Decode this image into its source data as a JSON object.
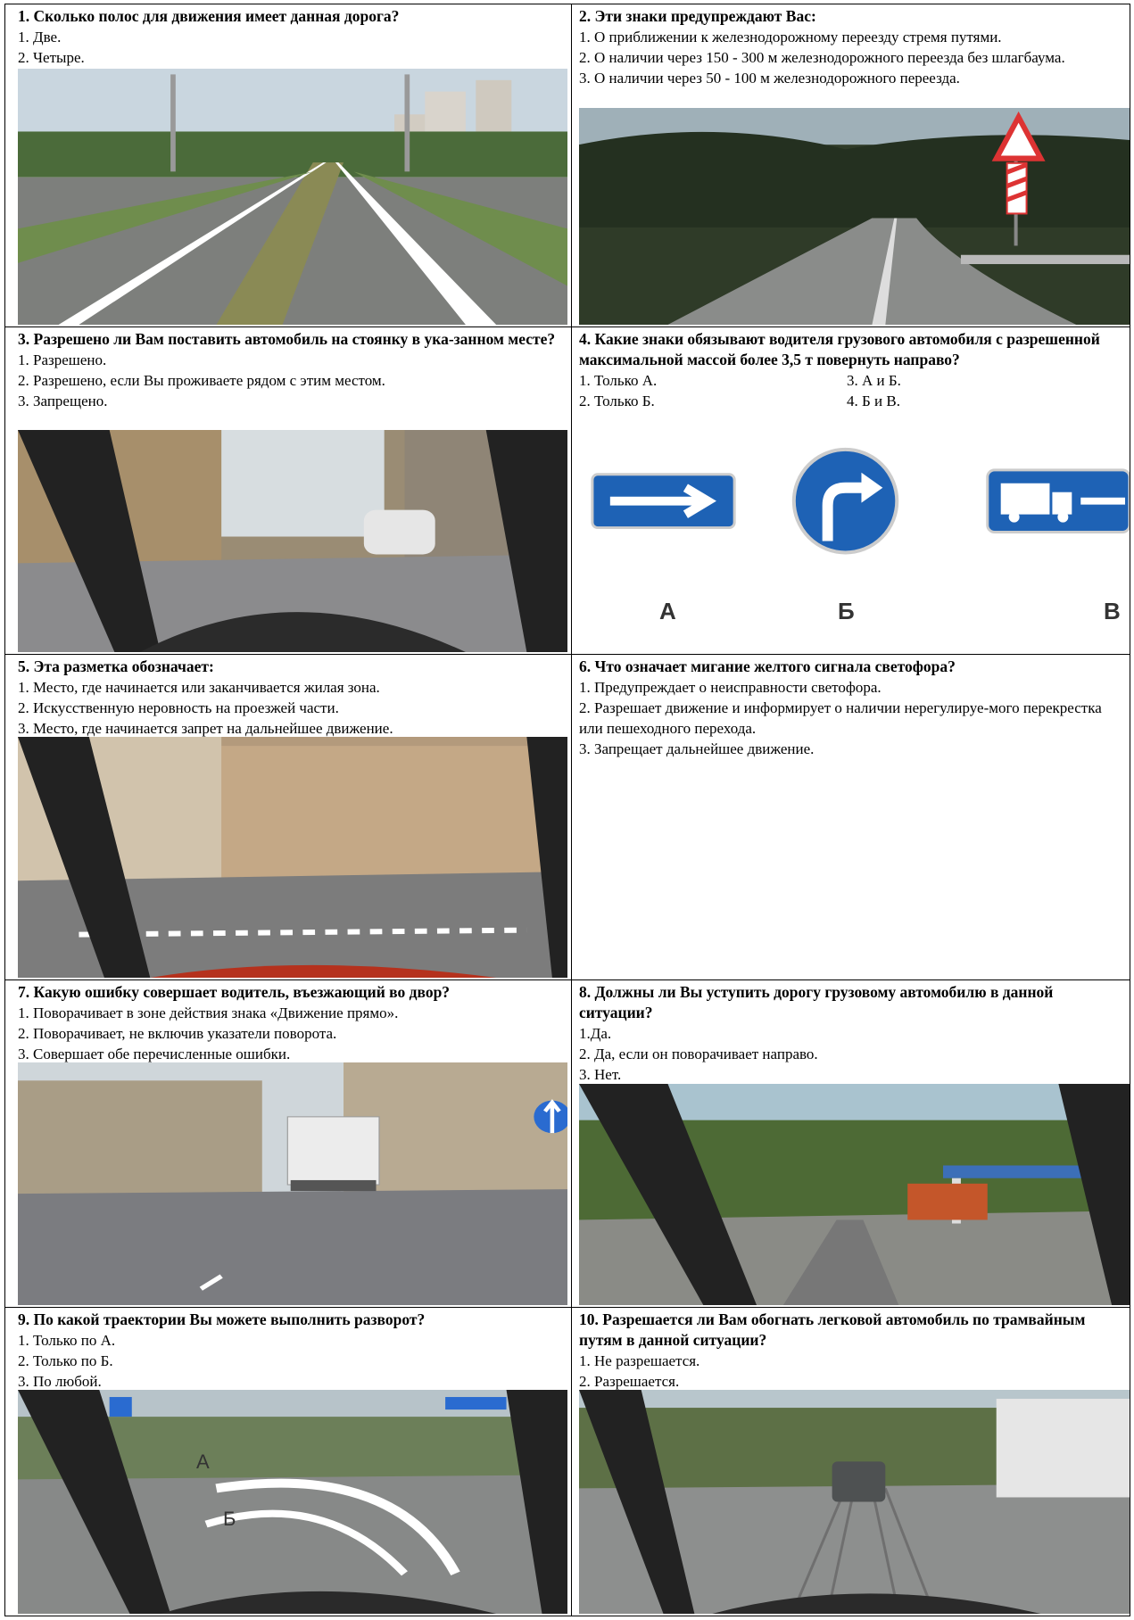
{
  "questions": [
    {
      "q": "1. Сколько полос для движения имеет данная дорога?",
      "a": [
        "1. Две.",
        "2. Четыре."
      ]
    },
    {
      "q": "2. Эти знаки предупреждают Вас:",
      "a": [
        "1. О приближении к железнодорожному переезду стремя путями.",
        "2. О наличии через 150 - 300 м железнодорожного переезда без шлагбаума.",
        "3. О наличии через 50 - 100 м железнодорожного переезда."
      ]
    },
    {
      "q": "3. Разрешено ли Вам поставить автомобиль на стоянку в ука-занном месте?",
      "a": [
        "1.  Разрешено.",
        "2.  Разрешено, если Вы проживаете рядом с этим местом.",
        "3.  Запрещено."
      ]
    },
    {
      "q": "4. Какие знаки обязывают водителя грузового автомобиля с разрешенной максимальной массой более 3,5 т повернуть направо?",
      "a": [
        "1. Только А.",
        "3. А и Б.",
        "2. Только Б.",
        "4.  Б и В."
      ],
      "labels": [
        "А",
        "Б",
        "В"
      ]
    },
    {
      "q": "5. Эта разметка обозначает:",
      "a": [
        "1.  Место, где начинается или заканчивается жилая зона.",
        "2.  Искусственную неровность на проезжей части.",
        "3.  Место, где начинается запрет на дальнейшее движение."
      ]
    },
    {
      "q": "6. Что означает мигание желтого сигнала светофора?",
      "a": [
        "1.  Предупреждает о неисправности светофора.",
        "2.  Разрешает движение и информирует о наличии нерегулируе-мого перекрестка или пешеходного перехода.",
        "3. Запрещает дальнейшее движение."
      ]
    },
    {
      "q": "7. Какую ошибку совершает водитель, въезжающий во двор?",
      "a": [
        "1.  Поворачивает в зоне действия знака «Движение прямо».",
        "2. Поворачивает, не включив указатели поворота.",
        "3. Совершает обе перечисленные ошибки."
      ]
    },
    {
      "q": "8. Должны ли Вы уступить дорогу грузовому автомобилю в данной ситуации?",
      "a": [
        "1.Да.",
        "2. Да, если он поворачивает направо.",
        "3. Нет."
      ]
    },
    {
      "q": "9. По какой траектории Вы можете выполнить разворот?",
      "a": [
        "1. Только по А.",
        "2. Только по Б.",
        "3.  По любой."
      ],
      "labels": [
        "А",
        "Б"
      ]
    },
    {
      "q": "10. Разрешается ли Вам обогнать легковой автомобиль по трамвайным путям в данной ситуации?",
      "a": [
        "1.  Не разрешается.",
        "2.  Разрешается."
      ]
    }
  ]
}
